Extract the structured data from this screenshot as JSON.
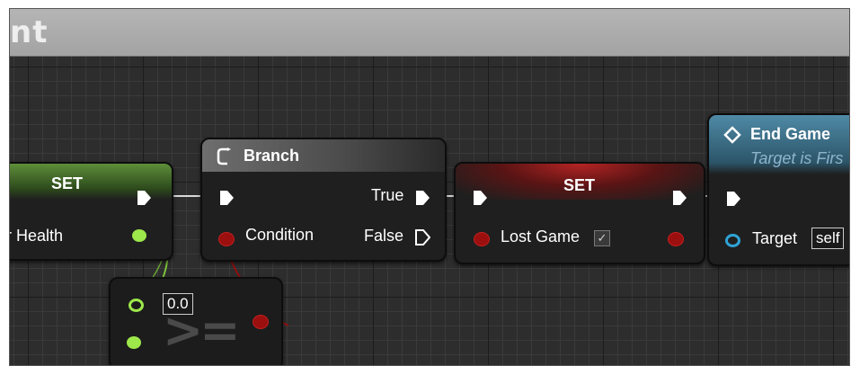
{
  "window": {
    "title_fragment": "nt"
  },
  "nodes": {
    "set_health": {
      "title": "SET",
      "pin_label": "er Health"
    },
    "branch": {
      "title": "Branch",
      "condition_label": "Condition",
      "true_label": "True",
      "false_label": "False"
    },
    "compare": {
      "operator": ">=",
      "input_value": "0.0"
    },
    "set_lost": {
      "title": "SET",
      "pin_label": "Lost Game",
      "checkbox": "✓"
    },
    "end_game": {
      "title": "End Game",
      "subtitle": "Target is Firs",
      "target_label": "Target",
      "target_value": "self"
    }
  },
  "colors": {
    "exec": "#ffffff",
    "float_pin": "#9de84a",
    "bool_pin": "#9b0f0f",
    "object_pin": "#2fa3d6",
    "set_header": "#4f7a33",
    "set_lost_header": "#8a1a1a",
    "end_game_header": "#3f6f86"
  }
}
